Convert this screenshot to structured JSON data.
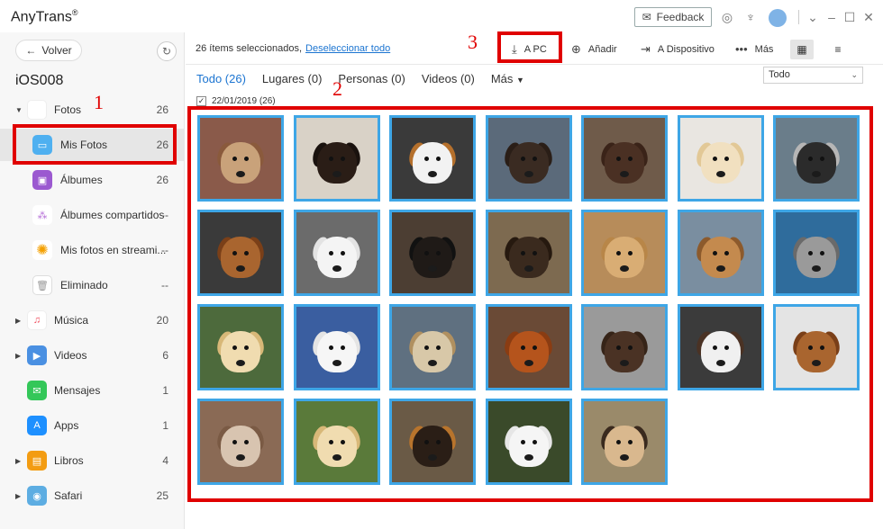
{
  "app": {
    "title": "AnyTrans",
    "reg": "®",
    "feedback_label": "Feedback"
  },
  "sidebar": {
    "back_label": "Volver",
    "device_name": "iOS008",
    "items": [
      {
        "label": "Fotos",
        "count": "26",
        "icon": "photos-icon",
        "color": "#f5a623"
      },
      {
        "label": "Mis Fotos",
        "count": "26",
        "icon": "my-photos-icon",
        "color": "#4fb0f0"
      },
      {
        "label": "Álbumes",
        "count": "26",
        "icon": "albums-icon",
        "color": "#9b59d0"
      },
      {
        "label": "Álbumes compartidos",
        "count": "--",
        "icon": "shared-albums-icon",
        "color": "#b36ad6"
      },
      {
        "label": "Mis fotos en streami...",
        "count": "--",
        "icon": "photo-stream-icon",
        "color": "#f4b400"
      },
      {
        "label": "Eliminado",
        "count": "--",
        "icon": "trash-icon",
        "color": "#bbbbbb"
      },
      {
        "label": "Música",
        "count": "20",
        "icon": "music-icon",
        "color": "#f04c5c"
      },
      {
        "label": "Videos",
        "count": "6",
        "icon": "videos-icon",
        "color": "#4a90e2"
      },
      {
        "label": "Mensajes",
        "count": "1",
        "icon": "messages-icon",
        "color": "#34c759"
      },
      {
        "label": "Apps",
        "count": "1",
        "icon": "apps-icon",
        "color": "#1e90ff"
      },
      {
        "label": "Libros",
        "count": "4",
        "icon": "books-icon",
        "color": "#f39c12"
      },
      {
        "label": "Safari",
        "count": "25",
        "icon": "safari-icon",
        "color": "#5dade2"
      }
    ]
  },
  "toolbar": {
    "selected_text": "26 ítems seleccionados,",
    "deselect_label": "Deseleccionar todo",
    "to_pc_label": "A PC",
    "add_label": "Añadir",
    "to_device_label": "A Dispositivo",
    "more_label": "Más"
  },
  "tabs": [
    "Todo (26)",
    "Lugares (0)",
    "Personas (0)",
    "Videos (0)",
    "Más"
  ],
  "filter": {
    "selected": "Todo"
  },
  "date_group": {
    "label": "22/01/2019 (26)"
  },
  "annotations": [
    "1",
    "2",
    "3"
  ],
  "photos": [
    {
      "bg": "#8a5a4a",
      "dog": "#c9a27a",
      "ear": "#8a5a3c"
    },
    {
      "bg": "#d9d2c7",
      "dog": "#2a1d16",
      "ear": "#1a120e"
    },
    {
      "bg": "#3a3a3a",
      "dog": "#f2f2f2",
      "ear": "#b5702c"
    },
    {
      "bg": "#5b6a7a",
      "dog": "#3a2b22",
      "ear": "#2a1e17"
    },
    {
      "bg": "#6f5b4a",
      "dog": "#4a3023",
      "ear": "#3a2318"
    },
    {
      "bg": "#e9e6e1",
      "dog": "#f1e0c0",
      "ear": "#e2c896"
    },
    {
      "bg": "#6a7d8a",
      "dog": "#2b2b2b",
      "ear": "#b6b6b6"
    },
    {
      "bg": "#3a3a3a",
      "dog": "#a9652f",
      "ear": "#7a3f18"
    },
    {
      "bg": "#6b6b6b",
      "dog": "#f4f4f4",
      "ear": "#e3e3e3"
    },
    {
      "bg": "#4c3e33",
      "dog": "#1f1a17",
      "ear": "#111111"
    },
    {
      "bg": "#7d6a50",
      "dog": "#3a2a1e",
      "ear": "#26190f"
    },
    {
      "bg": "#b78c5a",
      "dog": "#d9ad74",
      "ear": "#b88648"
    },
    {
      "bg": "#7a8ea0",
      "dog": "#c48a4e",
      "ear": "#8c5a2c"
    },
    {
      "bg": "#2f6c9c",
      "dog": "#9a9a9a",
      "ear": "#6a6a6a"
    },
    {
      "bg": "#4d6a3c",
      "dog": "#f0dcb0",
      "ear": "#d8b878"
    },
    {
      "bg": "#3a5ea0",
      "dog": "#f6f6f6",
      "ear": "#e4e4e4"
    },
    {
      "bg": "#5f7080",
      "dog": "#d8c8a8",
      "ear": "#b09060"
    },
    {
      "bg": "#6a4a36",
      "dog": "#b5541c",
      "ear": "#8a3c12"
    },
    {
      "bg": "#9a9a9a",
      "dog": "#4a3224",
      "ear": "#362418"
    },
    {
      "bg": "#3b3b3b",
      "dog": "#f0f0f0",
      "ear": "#4a3224"
    },
    {
      "bg": "#e4e4e4",
      "dog": "#a9652f",
      "ear": "#7a3f18"
    },
    {
      "bg": "#8a6a55",
      "dog": "#d8c4b0",
      "ear": "#7a5a44"
    },
    {
      "bg": "#5a7a3a",
      "dog": "#f0dcb0",
      "ear": "#d8b878"
    },
    {
      "bg": "#6a5a46",
      "dog": "#2a1e16",
      "ear": "#b8742c"
    },
    {
      "bg": "#3a4a2a",
      "dog": "#f5f5f5",
      "ear": "#e6e6e6"
    },
    {
      "bg": "#9a8a6a",
      "dog": "#d9b88e",
      "ear": "#3a2a1e"
    }
  ]
}
